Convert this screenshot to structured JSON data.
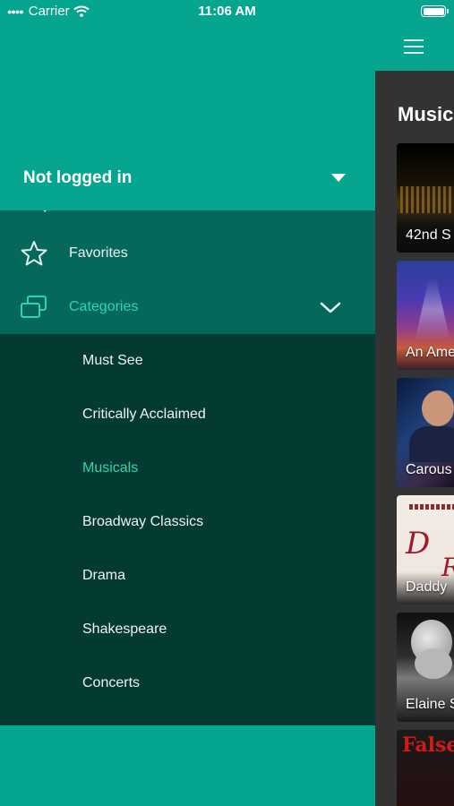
{
  "status_bar": {
    "carrier": "Carrier",
    "time": "11:06 AM"
  },
  "drawer": {
    "user_label": "Not logged in",
    "menu": {
      "favorites": "Favorites",
      "categories": "Categories"
    },
    "categories": [
      "Must See",
      "Critically Acclaimed",
      "Musicals",
      "Broadway Classics",
      "Drama",
      "Shakespeare",
      "Concerts"
    ],
    "active_category": "Musicals"
  },
  "content": {
    "title": "Musica",
    "cards": [
      {
        "label": "42nd S"
      },
      {
        "label": "An Ame"
      },
      {
        "label": "Carous"
      },
      {
        "label": "Daddy"
      },
      {
        "label": "Elaine S"
      },
      {
        "label": ""
      }
    ]
  },
  "colors": {
    "teal": "#06a58f",
    "menu_bg": "#04695b",
    "submenu_bg": "#033b33",
    "accent": "#32d3b4",
    "content_bg": "#333333"
  }
}
